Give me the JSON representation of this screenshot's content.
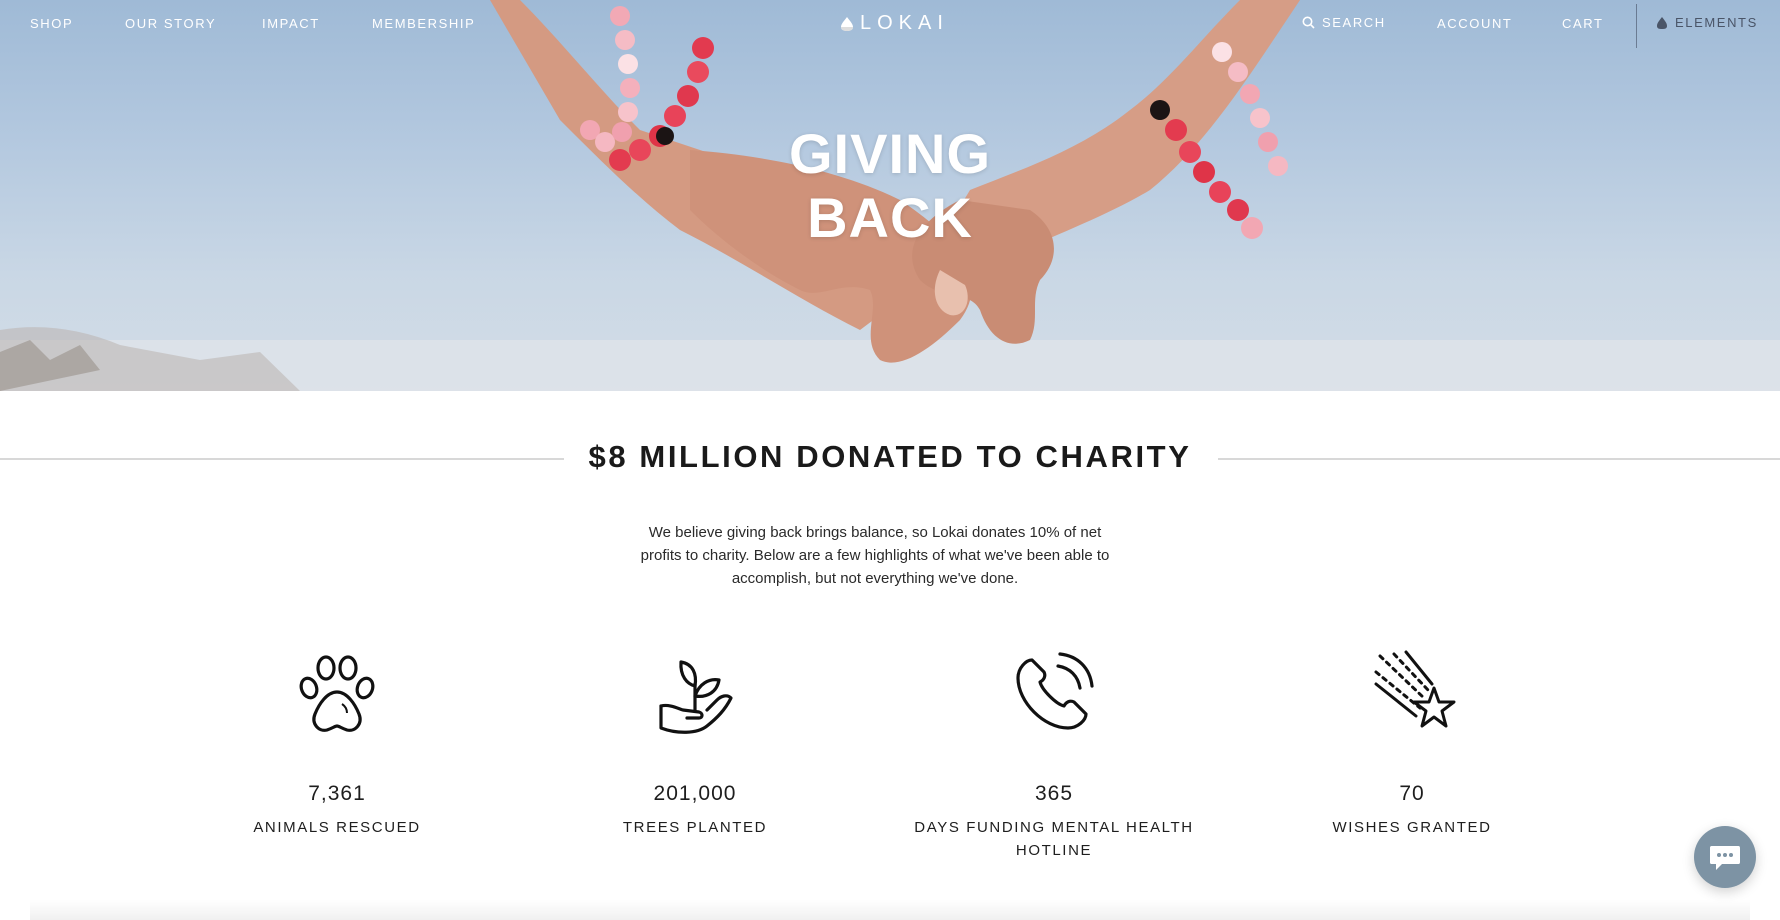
{
  "nav": {
    "shop": "SHOP",
    "our_story": "OUR STORY",
    "impact": "IMPACT",
    "membership": "MEMBERSHIP",
    "search": "SEARCH",
    "account": "ACCOUNT",
    "cart": "CART",
    "elements": "ELEMENTS",
    "logo": "LOKAI"
  },
  "hero": {
    "title_line1": "GIVING",
    "title_line2": "BACK"
  },
  "section": {
    "headline": "$8 MILLION DONATED TO CHARITY",
    "intro": "We believe giving back brings balance, so Lokai donates 10% of net profits to charity. Below are a few highlights of what we've been able to accomplish, but not everything we've done."
  },
  "stats": [
    {
      "icon": "paw-icon",
      "value": "7,361",
      "label": "ANIMALS RESCUED"
    },
    {
      "icon": "plant-in-hand-icon",
      "value": "201,000",
      "label": "TREES PLANTED"
    },
    {
      "icon": "phone-icon",
      "value": "365",
      "label": "DAYS FUNDING MENTAL HEALTH HOTLINE"
    },
    {
      "icon": "shooting-star-icon",
      "value": "70",
      "label": "WISHES GRANTED"
    }
  ],
  "colors": {
    "sky": "#b3c8df",
    "bead_red": "#e6364c",
    "bead_pink": "#f5b3bd",
    "chat_bubble": "#7d93a4",
    "text": "#1e1e1e"
  }
}
